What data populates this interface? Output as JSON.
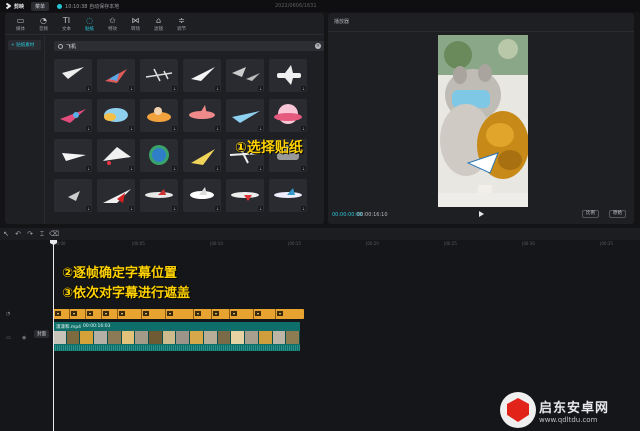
{
  "titlebar": {
    "app_name": "剪映",
    "menu_label": "菜单",
    "save_status": "10:10:38 自动保存本地",
    "window_title": "2022/0606/1631"
  },
  "toolbar": [
    {
      "label": "媒体",
      "icon": "media-icon",
      "glyph": "▭"
    },
    {
      "label": "音频",
      "icon": "audio-icon",
      "glyph": "◔"
    },
    {
      "label": "文本",
      "icon": "text-icon",
      "glyph": "TI"
    },
    {
      "label": "贴纸",
      "icon": "sticker-icon",
      "glyph": "◌",
      "active": true
    },
    {
      "label": "特效",
      "icon": "effects-icon",
      "glyph": "✩"
    },
    {
      "label": "转场",
      "icon": "transition-icon",
      "glyph": "⋈"
    },
    {
      "label": "滤镜",
      "icon": "filter-icon",
      "glyph": "⌂"
    },
    {
      "label": "调节",
      "icon": "adjust-icon",
      "glyph": "≑"
    }
  ],
  "sidebar": {
    "selected": "+ 贴纸素材"
  },
  "search": {
    "value": "飞机",
    "placeholder": ""
  },
  "annotations": {
    "step1": "①选择贴纸",
    "step2": "②逐帧确定字幕位置",
    "step3": "③依次对字幕进行遮盖"
  },
  "player": {
    "title": "播放器",
    "current_time": "00:00:00:00",
    "total_time": "00:00:16:10",
    "ratio_label": "比例",
    "fullscreen_label": "原始"
  },
  "timeline": {
    "ruler": [
      "00:00",
      "|00:05",
      "|00:10",
      "|00:15",
      "|00:20",
      "|00:25",
      "|00:30",
      "|00:35"
    ],
    "clip_name": "潇潇和.mp4",
    "clip_duration": "00:00:16:03",
    "cover_label": "封面"
  },
  "watermark": {
    "main": "启东安卓网",
    "sub": "www.qdltdu.com"
  }
}
